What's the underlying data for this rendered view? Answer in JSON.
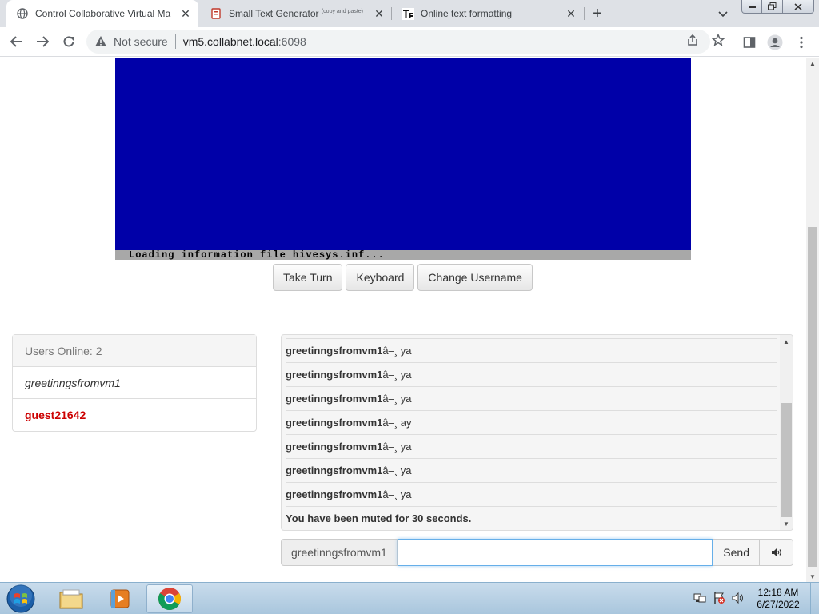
{
  "browser": {
    "tabs": [
      {
        "title": "Control Collaborative Virtual Ma",
        "icon": "globe-icon",
        "active": true
      },
      {
        "title": "Small Text Generator",
        "title_suffix": "(copy and paste)",
        "icon": "text-generator-icon",
        "active": false
      },
      {
        "title": "Online text formatting",
        "icon": "tf-icon",
        "active": false
      }
    ],
    "security_label": "Not secure",
    "url_host": "vm5.collabnet.local",
    "url_port": ":6098"
  },
  "vm": {
    "screen_color": "#0000a8",
    "status_line": "Loading information file hivesys.inf..."
  },
  "controls": {
    "take_turn": "Take Turn",
    "keyboard": "Keyboard",
    "change_username": "Change Username"
  },
  "users": {
    "header": "Users Online: 2",
    "list": [
      {
        "name": "greetinngsfromvm1"
      },
      {
        "name": "guest21642"
      }
    ]
  },
  "chat": {
    "messages": [
      {
        "user": "greetinngsfromvm1",
        "text": "â–¸ ya"
      },
      {
        "user": "greetinngsfromvm1",
        "text": "â–¸ ya"
      },
      {
        "user": "greetinngsfromvm1",
        "text": "â–¸ ya"
      },
      {
        "user": "greetinngsfromvm1",
        "text": "â–¸ ay"
      },
      {
        "user": "greetinngsfromvm1",
        "text": "â–¸ ya"
      },
      {
        "user": "greetinngsfromvm1",
        "text": "â–¸ ya"
      },
      {
        "user": "greetinngsfromvm1",
        "text": "â–¸ ya"
      }
    ],
    "system_message": "You have been muted for 30 seconds.",
    "username_label": "greetinngsfromvm1",
    "input_value": "",
    "send_label": "Send"
  },
  "taskbar": {
    "time": "12:18 AM",
    "date": "6/27/2022"
  }
}
